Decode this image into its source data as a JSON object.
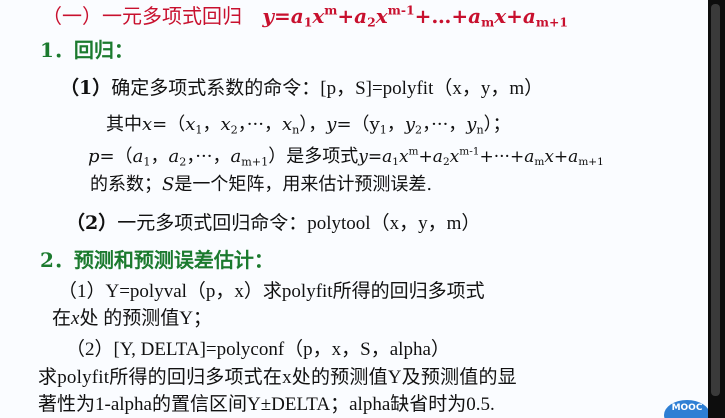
{
  "slide": {
    "heading": {
      "label": "（一）一元多项式回归",
      "formula": {
        "y": "y",
        "eq": "=",
        "a1": "a",
        "a1_sub": "1",
        "x1": "x",
        "x1_sup": "m",
        "plus1": "+",
        "a2": "a",
        "a2_sub": "2",
        "x2": "x",
        "x2_sup": "m-1",
        "plus_dots": "+…+",
        "am": "a",
        "am_sub": "m",
        "x3": "x",
        "plus3": "+",
        "am1": "a",
        "am1_sub": "m+1"
      }
    },
    "section1": {
      "title": "1．回归："
    },
    "item1": {
      "number": "（1）",
      "desc": "确定多项式系数的命令：",
      "command": "[p，S]=polyfit（x，y，m）"
    },
    "line_x": {
      "prefix": "其中",
      "x": "x",
      "eq": "=（",
      "x1": "x",
      "x1_sub": "1",
      "c1": "，",
      "x2": "x",
      "x2_sub": "2",
      "c2": "，···，",
      "xn": "x",
      "xn_sub": "n",
      "close": "），",
      "y": "y",
      "eq2": "=（",
      "y1": "y",
      "y1_sub": "1",
      "c3": "，",
      "y2": "y",
      "y2_sub": "2",
      "c4": "，···，",
      "yn": "y",
      "yn_sub": "n",
      "end": "）；"
    },
    "line_p": {
      "p": "p",
      "eq": "=（",
      "a1": "a",
      "a1_sub": "1",
      "c1": "，",
      "a2": "a",
      "a2_sub": "2",
      "c2": "，···，",
      "am1": "a",
      "am1_sub": "m+1",
      "mid": "）是多项式",
      "y": "y",
      "eq2": "=",
      "fa1": "a",
      "fa1_sub": "1",
      "fx1": "x",
      "fx1_sup": "m",
      "fp1": "+",
      "fa2": "a",
      "fa2_sub": "2",
      "fx2": "x",
      "fx2_sup": "m-1",
      "fp2": "+···+",
      "fam": "a",
      "fam_sub": "m",
      "fx3": "x",
      "fp3": "+",
      "fam1": "a",
      "fam1_sub": "m+1"
    },
    "line_coef": {
      "pre": "的系数；",
      "s": "S",
      "post": "是一个矩阵，用来估计预测误差."
    },
    "item2": {
      "number": "（2）",
      "desc": "一元多项式回归命令：",
      "command": "polytool（x，y，m）"
    },
    "section2": {
      "title": "2．预测和预测误差估计："
    },
    "pred1": {
      "line1": "（1）Y=polyval（p，x）求polyfit所得的回归多项式",
      "line2_a": "在",
      "line2_x": "x",
      "line2_b": "处 的预测值Y；"
    },
    "pred2": {
      "line1": "（2）[Y, DELTA]=polyconf（p，x，S，alpha）",
      "line2": "求polyfit所得的回归多项式在x处的预测值Y及预测值的显",
      "line3": "著性为1-alpha的置信区间Y±DELTA；alpha缺省时为0.5."
    },
    "logo": {
      "text": "MOOC"
    }
  }
}
